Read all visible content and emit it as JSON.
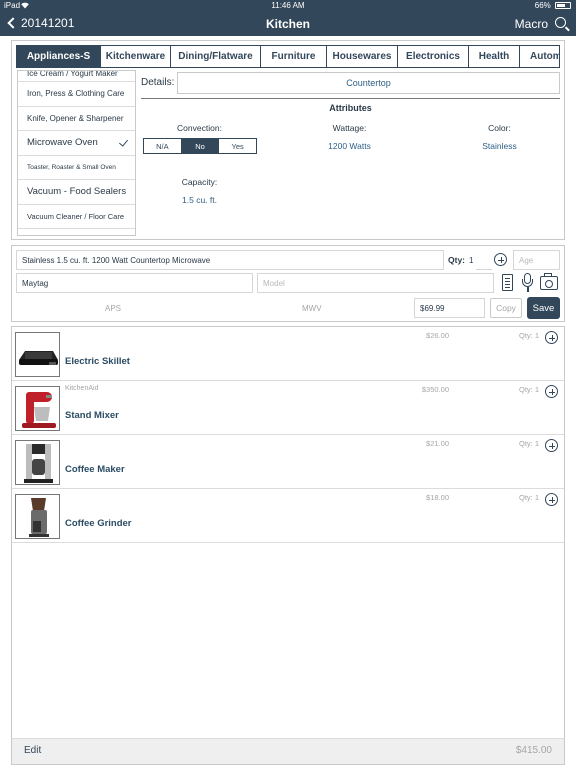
{
  "status_bar": {
    "device": "iPad",
    "time": "11:46 AM",
    "battery": "66%",
    "battery_level": 0.66
  },
  "nav": {
    "back_label": "20141201",
    "title": "Kitchen",
    "right_label": "Macro",
    "search_icon": "search-icon"
  },
  "tabs": [
    {
      "label": "Appliances-S",
      "active": true
    },
    {
      "label": "Kitchenware",
      "active": false
    },
    {
      "label": "Dining/Flatware",
      "active": false
    },
    {
      "label": "Furniture",
      "active": false
    },
    {
      "label": "Housewares",
      "active": false
    },
    {
      "label": "Electronics",
      "active": false
    },
    {
      "label": "Health",
      "active": false
    },
    {
      "label": "Automo",
      "active": false
    }
  ],
  "categories": [
    {
      "label": "Ice Cream / Yogurt Maker",
      "selected": false
    },
    {
      "label": "Iron, Press & Clothing Care",
      "selected": false
    },
    {
      "label": "Knife, Opener & Sharpener",
      "selected": false
    },
    {
      "label": "Microwave Oven",
      "selected": true
    },
    {
      "label": "Toaster, Roaster & Small Oven",
      "selected": false
    },
    {
      "label": "Vacuum - Food Sealers",
      "selected": false
    },
    {
      "label": "Vacuum Cleaner / Floor Care",
      "selected": false
    }
  ],
  "details": {
    "label": "Details:",
    "value": "Countertop",
    "attributes_title": "Attributes",
    "convection": {
      "label": "Convection:",
      "options": [
        "N/A",
        "No",
        "Yes"
      ],
      "selected": "No"
    },
    "wattage": {
      "label": "Wattage:",
      "value": "1200 Watts"
    },
    "color": {
      "label": "Color:",
      "value": "Stainless"
    },
    "capacity": {
      "label": "Capacity:",
      "value": "1.5 cu. ft."
    }
  },
  "editor": {
    "description": "Stainless 1.5 cu. ft. 1200 Watt Countertop Microwave",
    "qty_label": "Qty:",
    "qty_value": "1",
    "age_placeholder": "Age",
    "brand": "Maytag",
    "model_placeholder": "Model",
    "code_left": "APS",
    "code_right": "MWV",
    "price": "$69.99",
    "copy_label": "Copy",
    "save_label": "Save"
  },
  "items": [
    {
      "name": "Electric Skillet",
      "brand": "",
      "price": "$26.00",
      "qty": "Qty: 1",
      "thumb": "electric-skillet"
    },
    {
      "name": "Stand Mixer",
      "brand": "KitchenAid",
      "price": "$350.00",
      "qty": "Qty: 1",
      "thumb": "stand-mixer"
    },
    {
      "name": "Coffee Maker",
      "brand": "",
      "price": "$21.00",
      "qty": "Qty: 1",
      "thumb": "coffee-maker"
    },
    {
      "name": "Coffee Grinder",
      "brand": "",
      "price": "$18.00",
      "qty": "Qty: 1",
      "thumb": "coffee-grinder"
    }
  ],
  "footer": {
    "edit_label": "Edit",
    "total": "$415.00"
  },
  "colors": {
    "nav": "#33475a",
    "accent_text": "#2e5f86",
    "muted": "#a6a6a6",
    "stand_mixer_red": "#c0202a"
  }
}
